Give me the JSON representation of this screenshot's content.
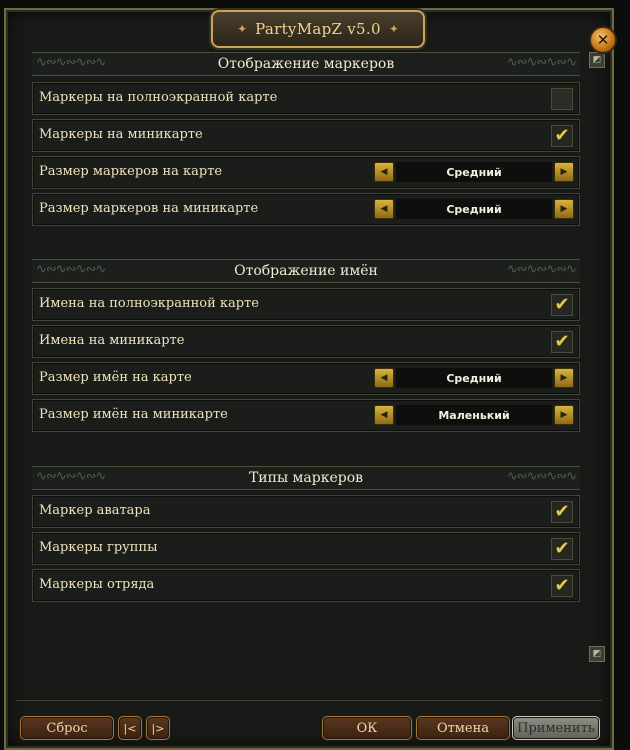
{
  "window": {
    "title": "PartyMapZ v5.0"
  },
  "sections": [
    {
      "title": "Отображение маркеров",
      "rows": [
        {
          "label": "Маркеры на полноэкранной карте",
          "type": "checkbox",
          "checked": false
        },
        {
          "label": "Маркеры на миникарте",
          "type": "checkbox",
          "checked": true
        },
        {
          "label": "Размер маркеров на карте",
          "type": "select",
          "value": "Средний"
        },
        {
          "label": "Размер маркеров на миникарте",
          "type": "select",
          "value": "Средний"
        }
      ]
    },
    {
      "title": "Отображение имён",
      "rows": [
        {
          "label": "Имена на полноэкранной карте",
          "type": "checkbox",
          "checked": true
        },
        {
          "label": "Имена на миникарте",
          "type": "checkbox",
          "checked": true
        },
        {
          "label": "Размер имён на карте",
          "type": "select",
          "value": "Средний"
        },
        {
          "label": "Размер имён на миникарте",
          "type": "select",
          "value": "Маленький"
        }
      ]
    },
    {
      "title": "Типы маркеров",
      "rows": [
        {
          "label": "Маркер аватара",
          "type": "checkbox",
          "checked": true
        },
        {
          "label": "Маркеры группы",
          "type": "checkbox",
          "checked": true
        },
        {
          "label": "Маркеры отряда",
          "type": "checkbox",
          "checked": true
        }
      ]
    }
  ],
  "footer": {
    "reset": "Сброс",
    "first_page": "|<",
    "next_page": "|>",
    "ok": "ОК",
    "cancel": "Отмена",
    "apply": "Применить"
  },
  "icons": {
    "close": "close-icon",
    "check": "checkmark-icon",
    "arrow_left": "arrow-left-icon",
    "arrow_right": "arrow-right-icon",
    "scroll_up": "scroll-up-icon",
    "scroll_down": "scroll-down-icon"
  },
  "colors": {
    "accent_gold": "#e7c94a",
    "text": "#efe3bd",
    "button_bg": "#4a2c17"
  }
}
